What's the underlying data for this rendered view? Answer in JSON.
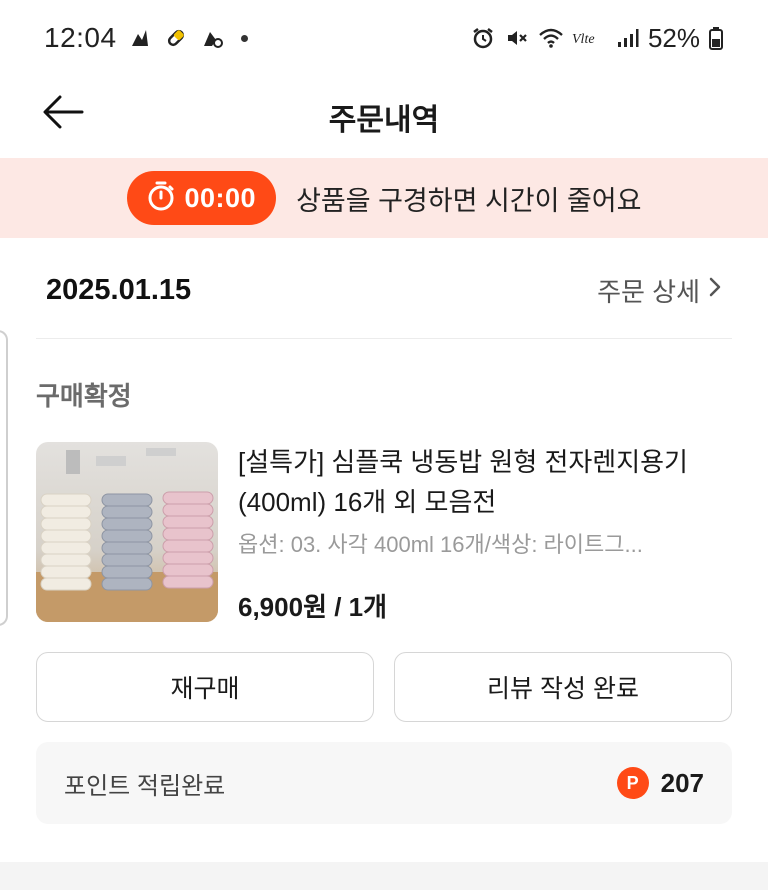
{
  "status_bar": {
    "time": "12:04",
    "battery": "52%",
    "left_icons": [
      "app-notification-icon",
      "pill-icon",
      "app-c-icon",
      "more-dot-icon"
    ],
    "right_icons": [
      "alarm-icon",
      "mute-icon",
      "wifi-icon",
      "volte-icon",
      "signal-icon",
      "battery-icon"
    ]
  },
  "header": {
    "title": "주문내역",
    "back_icon": "back-arrow-icon"
  },
  "timer_banner": {
    "timer": "00:00",
    "message": "상품을 구경하면 시간이 줄어요",
    "icon": "stopwatch-icon"
  },
  "order": {
    "date": "2025.01.15",
    "detail_link": "주문 상세",
    "status": "구매확정",
    "product": {
      "name": "[설특가] 심플쿡 냉동밥 원형 전자렌지용기(400ml) 16개 외 모음전",
      "option": "옵션: 03. 사각 400ml 16개/색상: 라이트그...",
      "price": "6,900원 / 1개"
    },
    "buttons": {
      "rebuy": "재구매",
      "review": "리뷰 작성 완료"
    },
    "points": {
      "label": "포인트 적립완료",
      "icon_letter": "P",
      "value": "207"
    }
  },
  "colors": {
    "accent": "#ff4a16",
    "banner_bg": "#fde8e4",
    "muted_text": "#9a9a9a"
  }
}
